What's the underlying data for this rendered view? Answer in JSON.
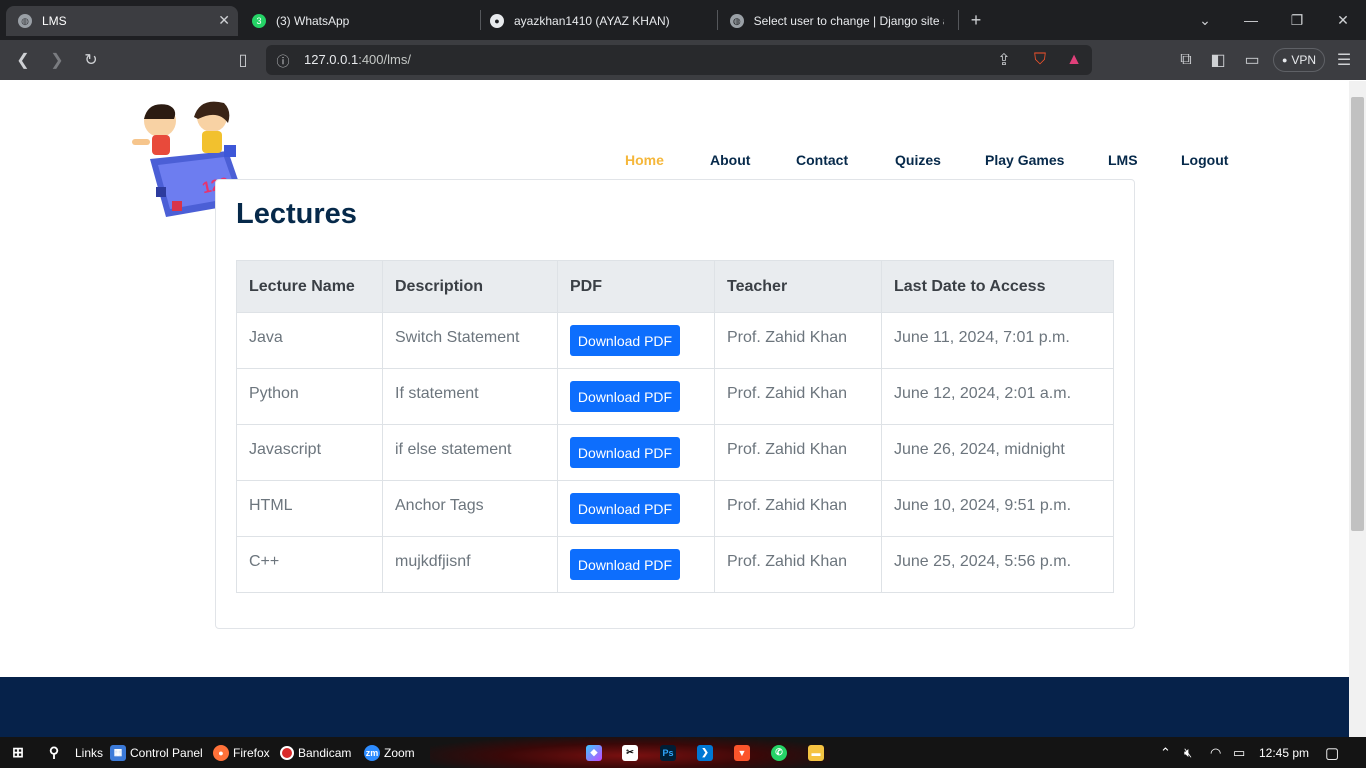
{
  "browser": {
    "tabs": [
      {
        "title": "LMS",
        "active": true
      },
      {
        "title": "(3) WhatsApp",
        "active": false
      },
      {
        "title": "ayazkhan1410 (AYAZ KHAN)",
        "active": false
      },
      {
        "title": "Select user to change | Django site a",
        "active": false
      }
    ],
    "new_tab": "+",
    "url_host": "127.0.0.1",
    "url_path": ":400/lms/",
    "vpn_label": "VPN"
  },
  "nav": {
    "items": [
      "Home",
      "About",
      "Contact",
      "Quizes",
      "Play Games",
      "LMS",
      "Logout"
    ],
    "active": "Home",
    "active_color": "#f5b73b",
    "text_color": "#06294a"
  },
  "content": {
    "heading": "Lectures",
    "columns": [
      "Lecture Name",
      "Description",
      "PDF",
      "Teacher",
      "Last Date to Access"
    ],
    "button_label": "Download PDF",
    "rows": [
      {
        "name": "Java",
        "description": "Switch Statement",
        "teacher": "Prof. Zahid Khan",
        "date": "June 11, 2024, 7:01 p.m."
      },
      {
        "name": "Python",
        "description": "If statement",
        "teacher": "Prof. Zahid Khan",
        "date": "June 12, 2024, 2:01 a.m."
      },
      {
        "name": "Javascript",
        "description": "if else statement",
        "teacher": "Prof. Zahid Khan",
        "date": "June 26, 2024, midnight"
      },
      {
        "name": "HTML",
        "description": "Anchor Tags",
        "teacher": "Prof. Zahid Khan",
        "date": "June 10, 2024, 9:51 p.m."
      },
      {
        "name": "C++",
        "description": "mujkdfjisnf",
        "teacher": "Prof. Zahid Khan",
        "date": "June 25, 2024, 5:56 p.m."
      }
    ],
    "button_color": "#0d6efd",
    "footer_color": "#06224a"
  },
  "taskbar": {
    "links": "Links",
    "control_panel": "Control Panel",
    "firefox": "Firefox",
    "bandicam": "Bandicam",
    "zoom": "Zoom",
    "time": "12:45 pm"
  }
}
